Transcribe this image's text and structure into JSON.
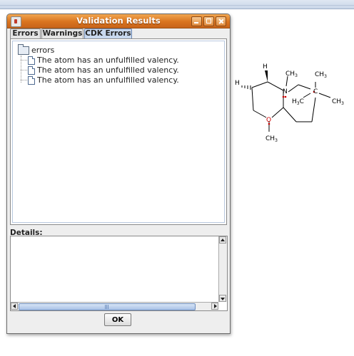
{
  "dialog": {
    "title": "Validation Results",
    "tabs": [
      {
        "label": "Errors"
      },
      {
        "label": "Warnings"
      },
      {
        "label": "CDK Errors",
        "selected": true
      }
    ],
    "tree": {
      "root_label": "errors",
      "items": [
        {
          "label": "The atom has an unfulfilled valency."
        },
        {
          "label": "The atom has an unfulfilled valency."
        },
        {
          "label": "The atom has an unfulfilled valency."
        }
      ]
    },
    "details_label": "Details:",
    "ok_label": "OK"
  },
  "molecule": {
    "labels": {
      "h_top": "H",
      "n_methyl": "CH",
      "n_methyl_sub": "3",
      "n_atom": "N",
      "c_methyl_top": "CH",
      "c_methyl_top_sub": "3",
      "h_left": "H",
      "h3c": "H",
      "h3c_sub": "3",
      "h3c_c": "C",
      "c_center": "C",
      "c_methyl_right": "CH",
      "c_methyl_right_sub": "3",
      "o_atom": "O",
      "o_methyl": "CH",
      "o_methyl_sub": "3"
    },
    "colors": {
      "bond": "#000000",
      "error_marker": "#cc0000",
      "atom_label": "#000000"
    }
  },
  "colors": {
    "titlebar": "#d9741f",
    "selected_tab": "#c8d8ee",
    "dialog_bg": "#eeeeee"
  }
}
